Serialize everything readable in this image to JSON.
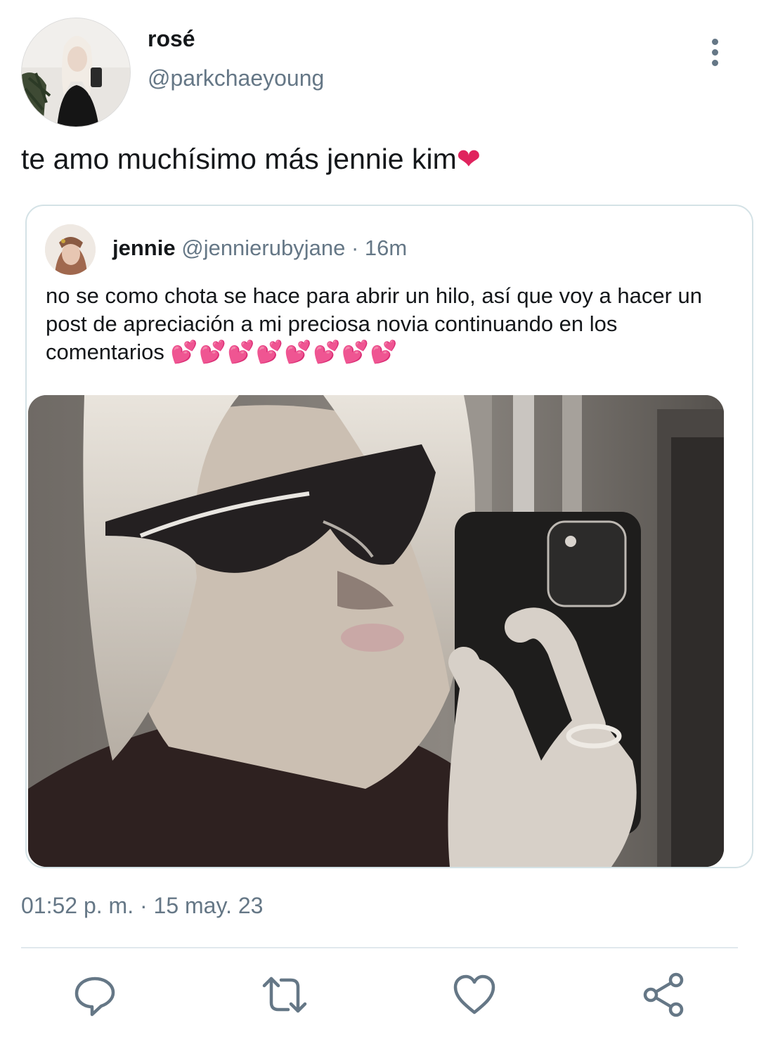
{
  "tweet": {
    "author_name": "rosé",
    "author_handle": "@parkchaeyoung",
    "text": "te amo muchísimo más jennie kim",
    "text_emoji": "❤",
    "timestamp": "01:52 p. m. · 15 may. 23"
  },
  "quoted_tweet": {
    "author_name": "jennie",
    "author_handle": "@jennierubyjane",
    "time": " · 16m",
    "text": "no se como chota se hace para abrir un hilo, así que voy a hacer un post de apreciación a mi preciosa novia continuando en los comentarios ",
    "emoji": "💕💕💕💕💕💕💕💕"
  },
  "icons": {
    "more": "more-vertical-icon",
    "reply": "reply-icon",
    "retweet": "retweet-icon",
    "like": "heart-icon",
    "share": "share-icon"
  },
  "colors": {
    "text_primary": "#14171a",
    "text_secondary": "#657786",
    "icon": "#657786",
    "heart": "#e0245e",
    "border": "#d4e2e6"
  }
}
